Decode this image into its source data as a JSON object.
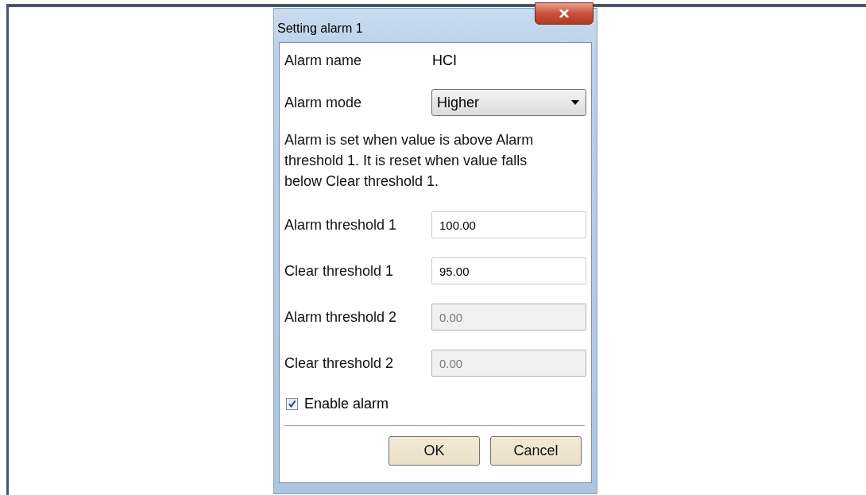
{
  "dialog": {
    "title": "Setting alarm 1",
    "alarm_name": {
      "label": "Alarm name",
      "value": "HCI"
    },
    "alarm_mode": {
      "label": "Alarm mode",
      "value": "Higher"
    },
    "description": "Alarm is set when value is above Alarm threshold 1. It is reset when value falls below Clear threshold 1.",
    "thresholds": [
      {
        "label": "Alarm threshold 1",
        "value": "100.00",
        "disabled": false
      },
      {
        "label": "Clear threshold 1",
        "value": "95.00",
        "disabled": false
      },
      {
        "label": "Alarm threshold 2",
        "value": "0.00",
        "disabled": true
      },
      {
        "label": "Clear threshold 2",
        "value": "0.00",
        "disabled": true
      }
    ],
    "enable_alarm": {
      "label": "Enable alarm",
      "checked": true
    },
    "buttons": [
      "OK",
      "Cancel"
    ]
  }
}
